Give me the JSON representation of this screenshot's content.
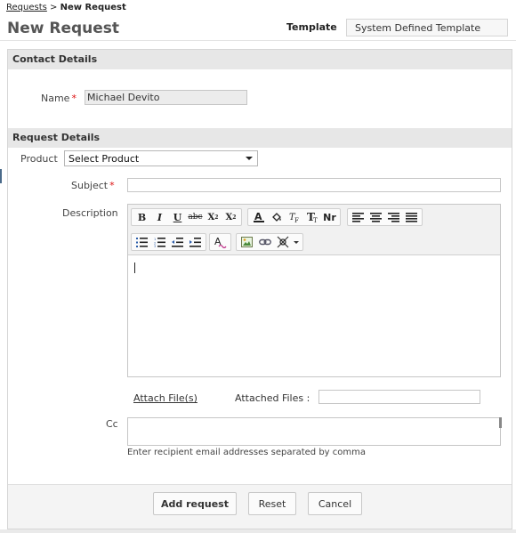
{
  "breadcrumb": {
    "parent": "Requests",
    "separator": ">",
    "current": "New Request"
  },
  "page_title": "New Request",
  "template": {
    "label": "Template",
    "value": "System Defined Template"
  },
  "contact_section": {
    "title": "Contact Details",
    "name_label": "Name",
    "required_mark": "*",
    "name_value": "Michael Devito"
  },
  "request_section": {
    "title": "Request Details",
    "product_label": "Product",
    "product_selected": "Select Product",
    "subject_label": "Subject",
    "description_label": "Description"
  },
  "editor_toolbar": {
    "row1": [
      {
        "name": "bold-button",
        "glyph": "B"
      },
      {
        "name": "italic-button",
        "glyph": "I"
      },
      {
        "name": "underline-button",
        "glyph": "U"
      },
      {
        "name": "strikethrough-button",
        "glyph": "abc"
      },
      {
        "name": "subscript-button",
        "glyph": "X2s"
      },
      {
        "name": "superscript-button",
        "glyph": "X2"
      }
    ],
    "row1b": [
      {
        "name": "font-color-icon",
        "glyph": "A"
      },
      {
        "name": "highlight-icon",
        "glyph": "fill"
      },
      {
        "name": "font-family-icon",
        "glyph": "F"
      },
      {
        "name": "font-size-icon",
        "glyph": "T"
      },
      {
        "name": "remove-format-icon",
        "glyph": "Nr"
      }
    ],
    "row1c": [
      "align-left-icon",
      "align-center-icon",
      "align-right-icon",
      "justify-icon"
    ],
    "row2a": [
      "bullet-list-icon",
      "numbered-list-icon",
      "outdent-icon",
      "indent-icon"
    ],
    "row2c": [
      "insert-image-icon",
      "insert-link-icon",
      "more-options-icon"
    ]
  },
  "attachments": {
    "attach_link": "Attach File(s)",
    "attached_label": "Attached Files :"
  },
  "cc": {
    "label": "Cc",
    "hint": "Enter recipient email addresses separated by comma"
  },
  "buttons": {
    "add": "Add request",
    "reset": "Reset",
    "cancel": "Cancel"
  }
}
